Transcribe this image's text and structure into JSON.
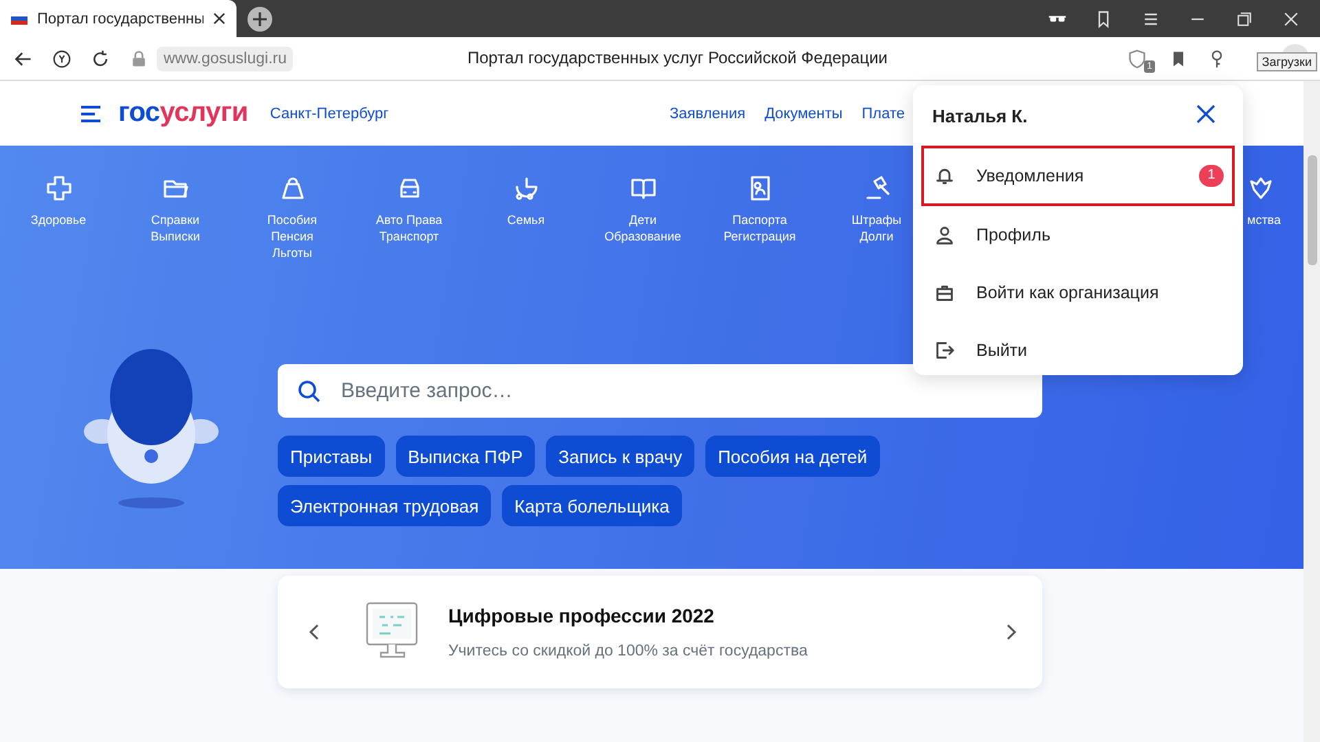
{
  "browser": {
    "tab_title": "Портал государственны",
    "url": "www.gosuslugi.ru",
    "page_title": "Портал государственных услуг Российской Федерации",
    "adblock_count": "1",
    "tooltip": "Загрузки"
  },
  "header": {
    "logo_left": "гос",
    "logo_right": "услуги",
    "region": "Санкт-Петербург",
    "nav": [
      "Заявления",
      "Документы",
      "Плате"
    ]
  },
  "categories": [
    {
      "lines": [
        "Здоровье"
      ]
    },
    {
      "lines": [
        "Справки",
        "Выписки"
      ]
    },
    {
      "lines": [
        "Пособия",
        "Пенсия",
        "Льготы"
      ]
    },
    {
      "lines": [
        "Авто Права",
        "Транспорт"
      ]
    },
    {
      "lines": [
        "Семья"
      ]
    },
    {
      "lines": [
        "Дети",
        "Образование"
      ]
    },
    {
      "lines": [
        "Паспорта",
        "Регистрация"
      ]
    },
    {
      "lines": [
        "Штрафы",
        "Долги"
      ]
    },
    {
      "lines": [
        "мства"
      ]
    }
  ],
  "search": {
    "placeholder": "Введите запрос…"
  },
  "chips": [
    [
      "Приставы",
      "Выписка ПФР",
      "Запись к врачу",
      "Пособия на детей"
    ],
    [
      "Электронная трудовая",
      "Карта болельщика"
    ]
  ],
  "promo": {
    "title": "Цифровые профессии 2022",
    "subtitle": "Учитесь со скидкой до 100% за счёт государства"
  },
  "menu": {
    "user": "Наталья К.",
    "items": [
      {
        "label": "Уведомления",
        "badge": "1",
        "selected": true
      },
      {
        "label": "Профиль",
        "selected": false
      },
      {
        "label": "Войти как организация",
        "selected": false
      },
      {
        "label": "Выйти",
        "selected": false
      }
    ]
  }
}
